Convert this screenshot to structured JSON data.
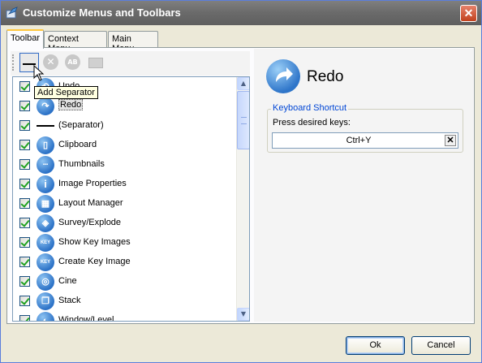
{
  "window": {
    "title": "Customize Menus and Toolbars",
    "close_glyph": "✕"
  },
  "tabs": [
    {
      "label": "Toolbar",
      "active": true
    },
    {
      "label": "Context Menu",
      "active": false
    },
    {
      "label": "Main Menu",
      "active": false
    }
  ],
  "toolbar": {
    "buttons": [
      {
        "name": "add-separator-icon",
        "enabled": true
      },
      {
        "name": "remove-icon",
        "enabled": false,
        "glyph": "✕"
      },
      {
        "name": "rename-icon",
        "enabled": false,
        "glyph": "AB"
      },
      {
        "name": "new-folder-icon",
        "enabled": false
      }
    ],
    "tooltip": "Add Separator"
  },
  "list": {
    "items": [
      {
        "label": "Undo",
        "checked": true,
        "icon": "undo-icon",
        "glyph": "↶"
      },
      {
        "label": "Redo",
        "checked": true,
        "icon": "redo-icon",
        "glyph": "↷",
        "selected": true
      },
      {
        "label": "(Separator)",
        "checked": true,
        "icon": "separator-icon",
        "glyph": ""
      },
      {
        "label": "Clipboard",
        "checked": true,
        "icon": "clipboard-icon",
        "glyph": "▯"
      },
      {
        "label": "Thumbnails",
        "checked": true,
        "icon": "thumbnails-icon",
        "glyph": "▪▪▪"
      },
      {
        "label": "Image Properties",
        "checked": true,
        "icon": "info-icon",
        "glyph": "i"
      },
      {
        "label": "Layout Manager",
        "checked": true,
        "icon": "layout-icon",
        "glyph": "▦"
      },
      {
        "label": "Survey/Explode",
        "checked": true,
        "icon": "survey-icon",
        "glyph": "◈"
      },
      {
        "label": "Show Key Images",
        "checked": true,
        "icon": "key-images-icon",
        "glyph": "KEY"
      },
      {
        "label": "Create Key Image",
        "checked": true,
        "icon": "create-key-icon",
        "glyph": "KEY"
      },
      {
        "label": "Cine",
        "checked": true,
        "icon": "cine-icon",
        "glyph": "◎"
      },
      {
        "label": "Stack",
        "checked": true,
        "icon": "stack-icon",
        "glyph": "❐"
      },
      {
        "label": "Window/Level",
        "checked": true,
        "icon": "window-level-icon",
        "glyph": "◐"
      }
    ]
  },
  "detail": {
    "title": "Redo",
    "icon": "redo-icon",
    "shortcut_group_label": "Keyboard Shortcut",
    "press_label": "Press desired keys:",
    "shortcut_value": "Ctrl+Y",
    "clear_glyph": "✕"
  },
  "footer": {
    "ok_label": "Ok",
    "cancel_label": "Cancel"
  },
  "colors": {
    "accent": "#316ac5",
    "icon_blue": "#2c72c7",
    "title_bar": "#6a6a6a",
    "legend": "#0046d5"
  }
}
